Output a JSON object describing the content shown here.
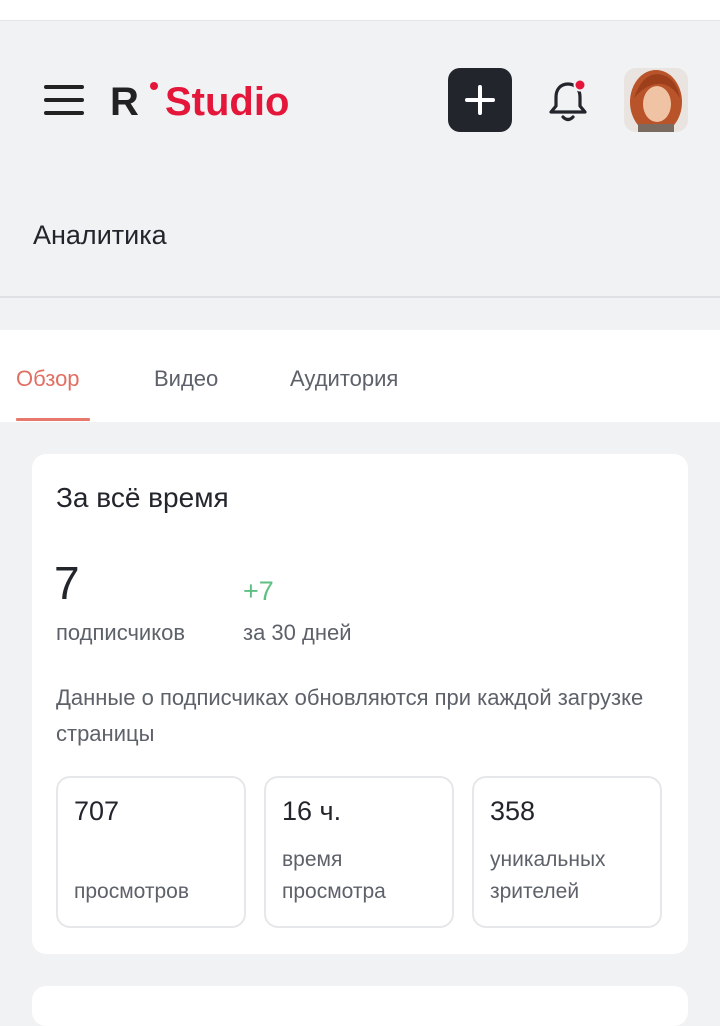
{
  "header": {
    "logo_text": "Studio",
    "logo_letter": "R",
    "menu_icon": "hamburger-icon",
    "add_icon": "plus-icon",
    "bell_icon": "bell-icon",
    "has_notification": true
  },
  "page": {
    "title": "Аналитика"
  },
  "tabs": [
    {
      "label": "Обзор",
      "active": true
    },
    {
      "label": "Видео",
      "active": false
    },
    {
      "label": "Аудитория",
      "active": false
    }
  ],
  "overview": {
    "title": "За всё время",
    "subscribers": "7",
    "subscribers_label": "подписчиков",
    "delta": "+7",
    "delta_label": "за 30 дней",
    "note": "Данные о подписчиках обновляются при каждой загрузке страницы",
    "stats": [
      {
        "value": "707",
        "label": "просмотров"
      },
      {
        "value": "16 ч.",
        "label": "время просмотра"
      },
      {
        "value": "358",
        "label": "уникальных зрителей"
      }
    ]
  },
  "colors": {
    "accent": "#e8786b",
    "logo_red": "#e4163a",
    "positive": "#5fbf83",
    "dark": "#22252b"
  }
}
